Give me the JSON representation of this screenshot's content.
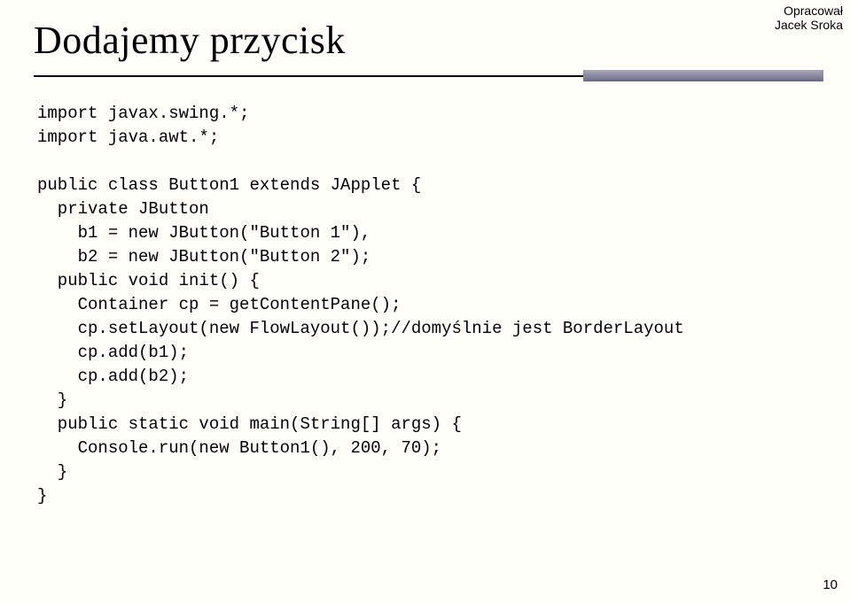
{
  "attribution": {
    "line1": "Opracował",
    "line2": "Jacek Sroka"
  },
  "title": "Dodajemy przycisk",
  "code": {
    "l01": "import javax.swing.*;",
    "l02": "import java.awt.*;",
    "l03": "",
    "l04": "public class Button1 extends JApplet {",
    "l05": "  private JButton",
    "l06": "    b1 = new JButton(\"Button 1\"),",
    "l07": "    b2 = new JButton(\"Button 2\");",
    "l08": "  public void init() {",
    "l09": "    Container cp = getContentPane();",
    "l10": "    cp.setLayout(new FlowLayout());//domyślnie jest BorderLayout",
    "l11": "    cp.add(b1);",
    "l12": "    cp.add(b2);",
    "l13": "  }",
    "l14": "  public static void main(String[] args) {",
    "l15": "    Console.run(new Button1(), 200, 70);",
    "l16": "  }",
    "l17": "}"
  },
  "pagenum": "10"
}
